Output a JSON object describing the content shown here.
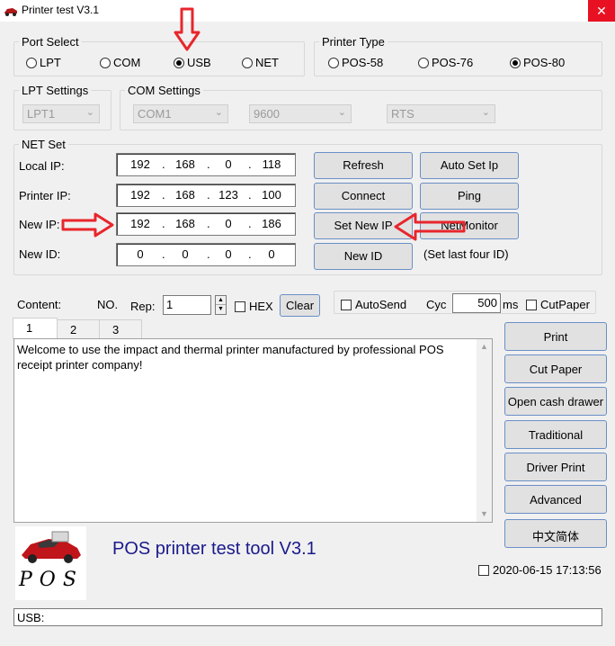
{
  "window": {
    "title": "Printer test V3.1",
    "close_glyph": "✕"
  },
  "port_select": {
    "legend": "Port Select",
    "options": [
      {
        "label": "LPT",
        "selected": false
      },
      {
        "label": "COM",
        "selected": false
      },
      {
        "label": "USB",
        "selected": true
      },
      {
        "label": "NET",
        "selected": false
      }
    ]
  },
  "printer_type": {
    "legend": "Printer Type",
    "options": [
      {
        "label": "POS-58",
        "selected": false
      },
      {
        "label": "POS-76",
        "selected": false
      },
      {
        "label": "POS-80",
        "selected": true
      }
    ]
  },
  "lpt_settings": {
    "legend": "LPT Settings",
    "port": "LPT1"
  },
  "com_settings": {
    "legend": "COM Settings",
    "port": "COM1",
    "baud": "9600",
    "flow": "RTS"
  },
  "net_set": {
    "legend": "NET Set",
    "rows": [
      {
        "label": "Local IP:",
        "ip": [
          "192",
          "168",
          "0",
          "118"
        ]
      },
      {
        "label": "Printer IP:",
        "ip": [
          "192",
          "168",
          "123",
          "100"
        ]
      },
      {
        "label": "New IP:",
        "ip": [
          "192",
          "168",
          "0",
          "186"
        ]
      },
      {
        "label": "New ID:",
        "ip": [
          "0",
          "0",
          "0",
          "0"
        ]
      }
    ],
    "buttons": {
      "refresh": "Refresh",
      "connect": "Connect",
      "set_new_ip": "Set New IP",
      "new_id": "New ID",
      "auto_set_ip": "Auto Set Ip",
      "ping": "Ping",
      "net_monitor": "NetMonitor"
    },
    "hint": "(Set last four ID)"
  },
  "content_bar": {
    "content_label": "Content:",
    "no_label": "NO.",
    "rep_label": "Rep:",
    "rep_value": "1",
    "hex_label": "HEX",
    "clear_label": "Clear",
    "autosend_label": "AutoSend",
    "cyc_label": "Cyc",
    "cyc_value": "500",
    "ms_label": "ms",
    "cutpaper_label": "CutPaper"
  },
  "tabs": [
    "1",
    "2",
    "3"
  ],
  "text_content": "Welcome to use the impact and thermal printer manufactured by professional POS receipt printer company!",
  "side_buttons": [
    "Print",
    "Cut Paper",
    "Open cash drawer",
    "Traditional",
    "Driver Print",
    "Advanced",
    "中文简体"
  ],
  "footer": {
    "tool_title": "POS printer test tool V3.1",
    "logo_text": "POS",
    "datetime": "2020-06-15 17:13:56",
    "status": "USB:"
  },
  "colors": {
    "annotation_red": "#e8262c",
    "title_blue": "#1a1a8c",
    "close_red": "#e81123"
  }
}
